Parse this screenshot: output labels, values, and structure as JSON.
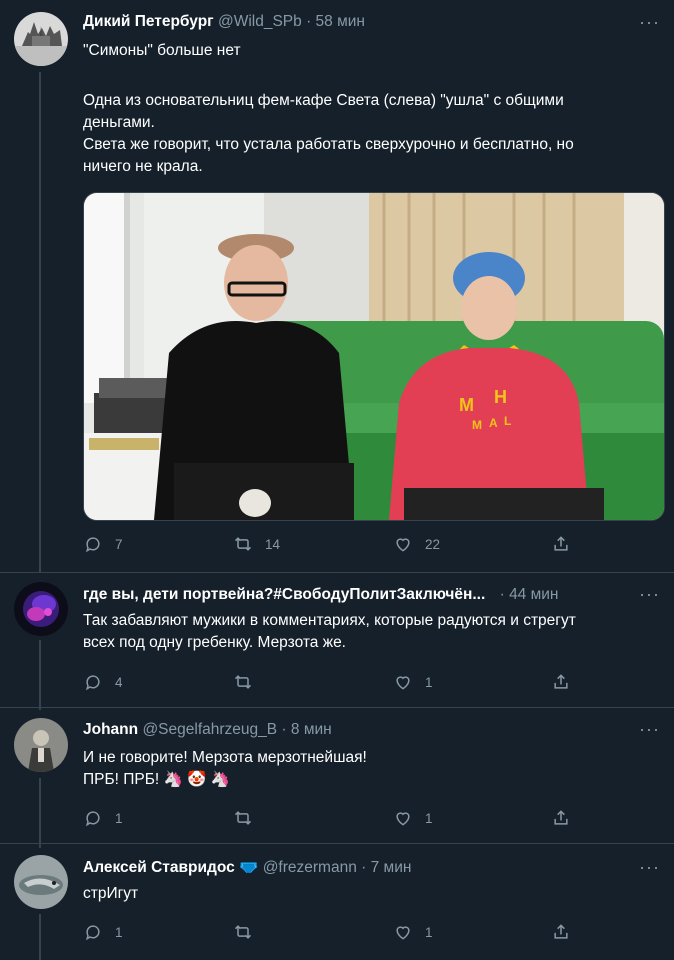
{
  "more_label": "···",
  "tweets": [
    {
      "name": "Дикий Петербург",
      "handle": "@Wild_SPb",
      "sep": "·",
      "time": "58 мин",
      "lines": [
        "\"Симоны\" больше нет",
        "",
        "Одна из основательниц фем-кафе Света (слева) \"ушла\" с общими",
        "деньгами.",
        "Света же говорит, что устала работать сверхурочно и бесплатно, но",
        "ничего не крала."
      ],
      "image_print": [
        "М",
        "Н",
        "М",
        "А",
        "L"
      ],
      "replies": "7",
      "retweets": "14",
      "likes": "22"
    },
    {
      "name": "где вы, дети портвейна?#СвободуПолитЗаключён...",
      "sep": "·",
      "time": "44 мин",
      "lines": [
        "Так забавляют мужики в комментариях, которые радуются и стрегут",
        "всех под одну гребенку. Мерзота же."
      ],
      "replies": "4",
      "retweets": "",
      "likes": "1"
    },
    {
      "name": "Johann",
      "handle": "@Segelfahrzeug_B",
      "sep": "·",
      "time": "8 мин",
      "lines": [
        "И не говорите! Мерзота мерзотнейшая!",
        "ПРБ! ПРБ!"
      ],
      "emoji": [
        "🦄",
        "🤡",
        "🦄"
      ],
      "replies": "1",
      "retweets": "",
      "likes": "1"
    },
    {
      "name": "Алексей Ставридос",
      "name_emoji": "🩲",
      "handle": "@frezermann",
      "sep": "·",
      "time": "7 мин",
      "lines": [
        "стрИгут"
      ],
      "replies": "1",
      "retweets": "",
      "likes": "1"
    }
  ],
  "colors": {
    "background": "#15202b",
    "secondary_text": "#8899a6",
    "divider": "#38444d"
  }
}
